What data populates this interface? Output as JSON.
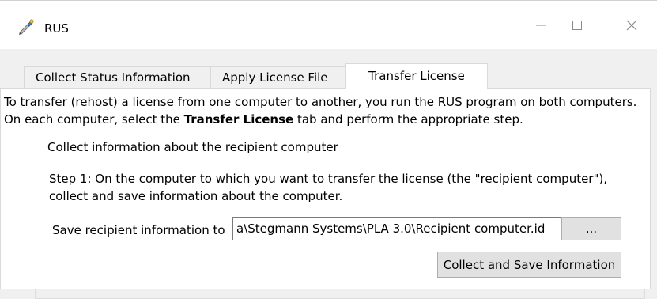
{
  "window": {
    "title": "RUS",
    "icon": "pen-key-icon",
    "controls": {
      "minimize": "minimize-icon",
      "maximize": "maximize-icon",
      "close": "close-icon"
    }
  },
  "tabs": [
    {
      "label": "Collect Status Information",
      "active": false
    },
    {
      "label": "Apply License File",
      "active": false
    },
    {
      "label": "Transfer License",
      "active": true
    }
  ],
  "transfer": {
    "intro_part1": "To transfer (rehost) a license from one computer to another, you run the RUS program on both computers. On each computer, select the ",
    "intro_bold": "Transfer License",
    "intro_part2": " tab and perform the appropriate step.",
    "group_title": "Collect information about the recipient computer",
    "step1_text": "Step 1: On the computer to which you want to transfer the license (the \"recipient computer\"), collect and save information about the computer.",
    "save_label": "Save recipient information to",
    "save_path": "a\\Stegmann Systems\\PLA 3.0\\Recipient computer.id",
    "browse_label": "...",
    "collect_button": "Collect and Save Information"
  }
}
